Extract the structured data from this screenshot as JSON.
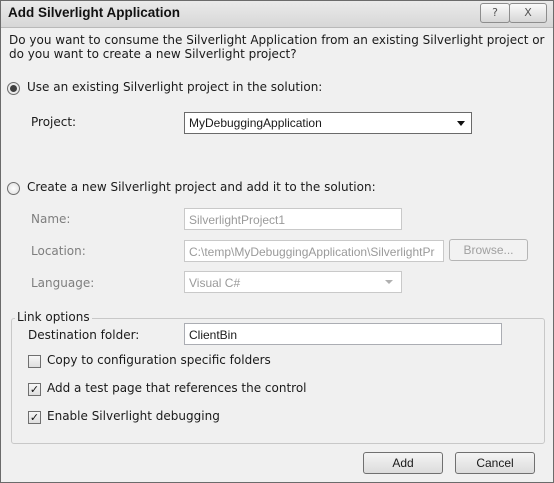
{
  "window": {
    "title": "Add Silverlight Application",
    "help_glyph": "?",
    "close_glyph": "X"
  },
  "question": {
    "line1": "Do you want to consume the Silverlight Application from an existing Silverlight project or",
    "line2": "do you want to create a new Silverlight project?"
  },
  "existing": {
    "radio_label": "Use an existing Silverlight project in the solution:",
    "selected": true,
    "project_label": "Project:",
    "project_value": "MyDebuggingApplication"
  },
  "new_project": {
    "radio_label": "Create a new Silverlight project and add it to the solution:",
    "selected": false,
    "name_label": "Name:",
    "name_value": "SilverlightProject1",
    "location_label": "Location:",
    "location_value": "C:\\temp\\MyDebuggingApplication\\SilverlightPr",
    "browse_label": "Browse...",
    "language_label": "Language:",
    "language_value": "Visual C#"
  },
  "link_options": {
    "legend": "Link options",
    "destination_label": "Destination folder:",
    "destination_value": "ClientBin",
    "copy_config_label": "Copy to configuration specific folders",
    "copy_config_checked": false,
    "test_page_label": "Add a test page that references the control",
    "test_page_checked": true,
    "debugging_label": "Enable Silverlight debugging",
    "debugging_checked": true
  },
  "buttons": {
    "add": "Add",
    "cancel": "Cancel"
  }
}
